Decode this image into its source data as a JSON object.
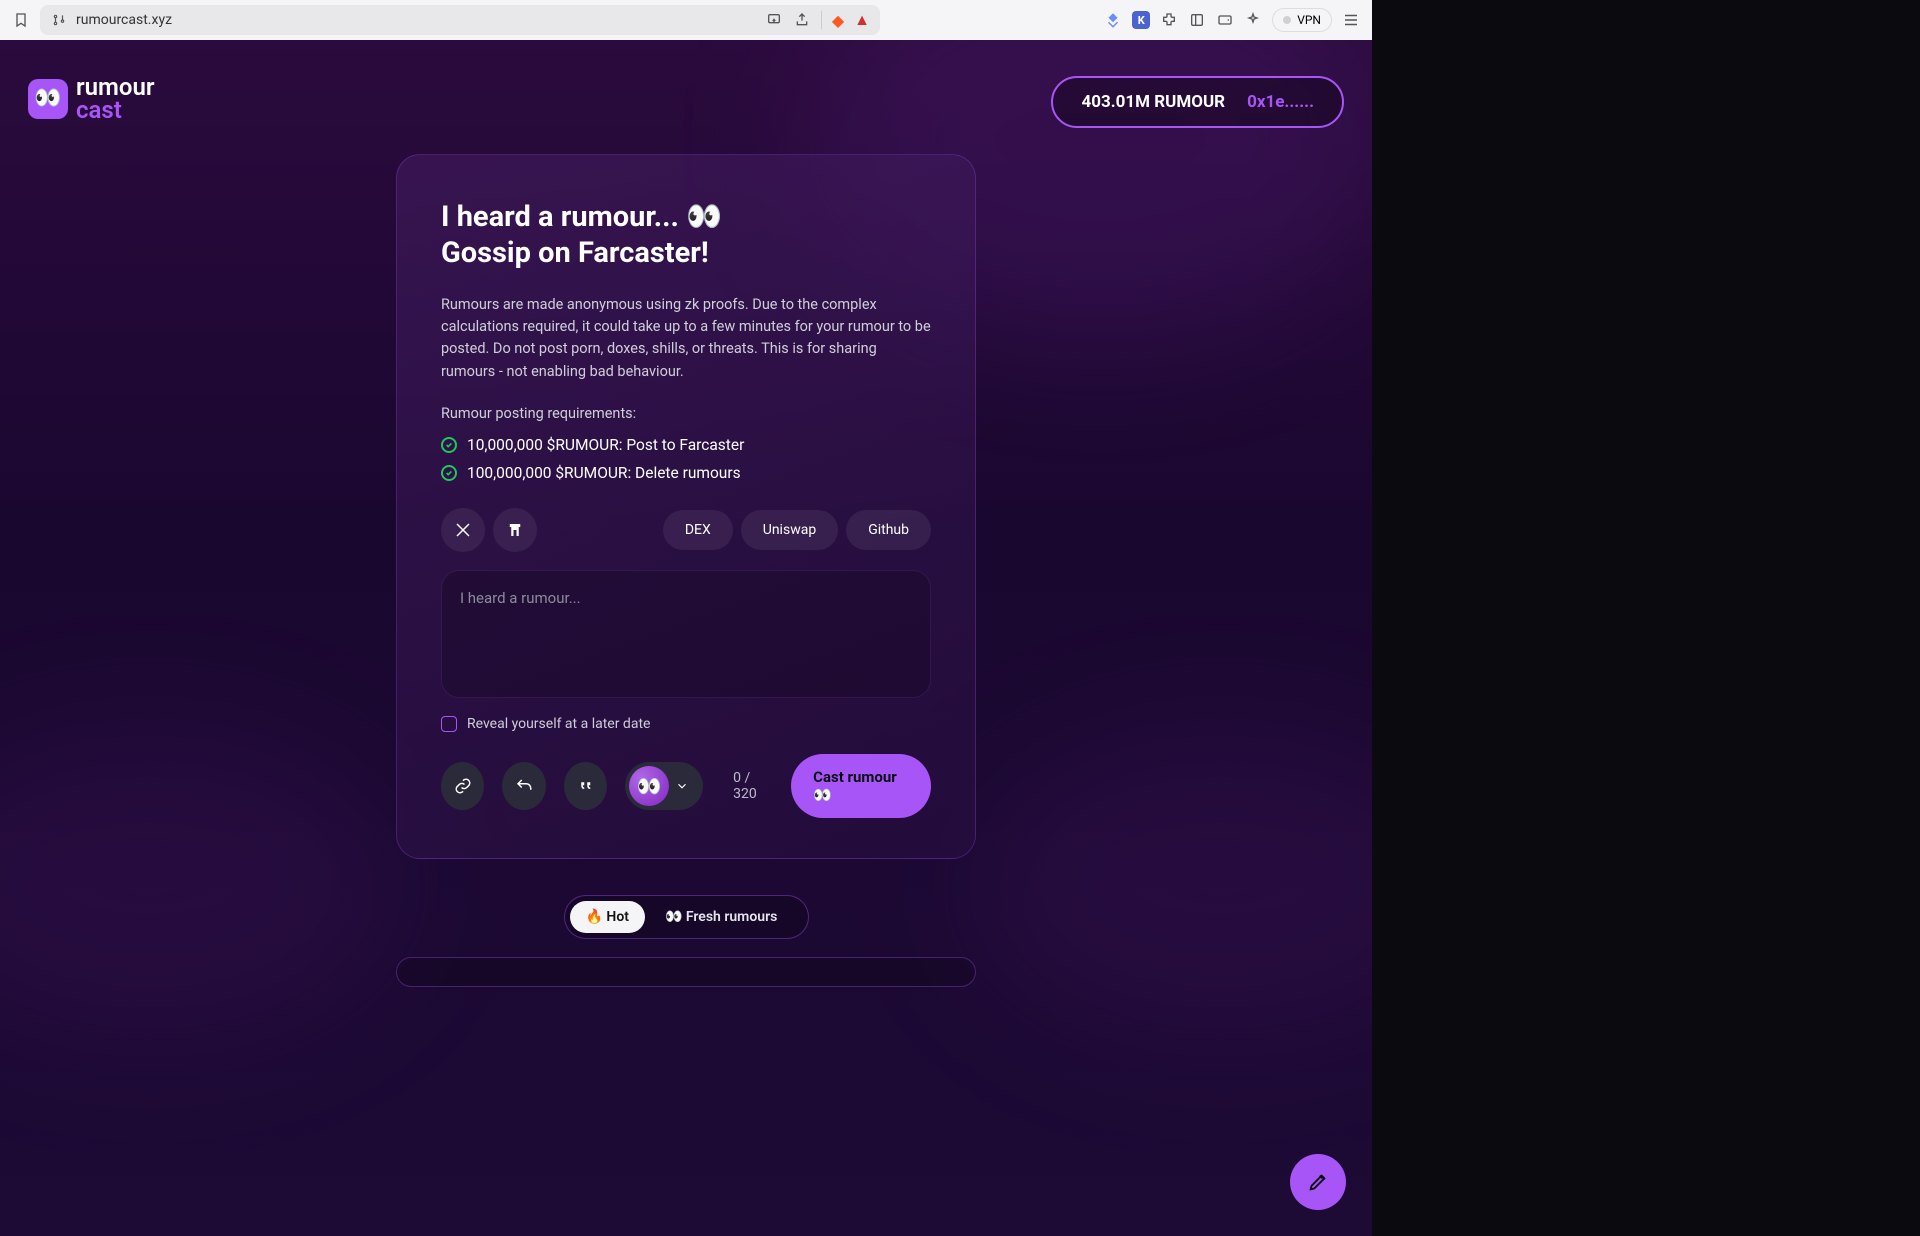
{
  "browser": {
    "url": "rumourcast.xyz",
    "vpn_label": "VPN"
  },
  "header": {
    "logo_line1": "rumour",
    "logo_line2": "cast",
    "wallet_balance": "403.01M RUMOUR",
    "wallet_address": "0x1e......"
  },
  "card": {
    "title_line1": "I heard a rumour... 👀",
    "title_line2": "Gossip on Farcaster!",
    "description": "Rumours are made anonymous using zk proofs. Due to the complex calculations required, it could take up to a few minutes for your rumour to be posted. Do not post porn, doxes, shills, or threats. This is for sharing rumours - not enabling bad behaviour.",
    "requirements_heading": "Rumour posting requirements:",
    "requirements": [
      "10,000,000 $RUMOUR: Post to Farcaster",
      "100,000,000 $RUMOUR: Delete rumours"
    ],
    "links": {
      "dex": "DEX",
      "uniswap": "Uniswap",
      "github": "Github"
    },
    "input_placeholder": "I heard a rumour...",
    "reveal_label": "Reveal yourself at a later date",
    "char_counter": "0 / 320",
    "cast_button": "Cast rumour 👀"
  },
  "tabs": {
    "hot": "🔥 Hot",
    "fresh": "👀 Fresh rumours"
  }
}
